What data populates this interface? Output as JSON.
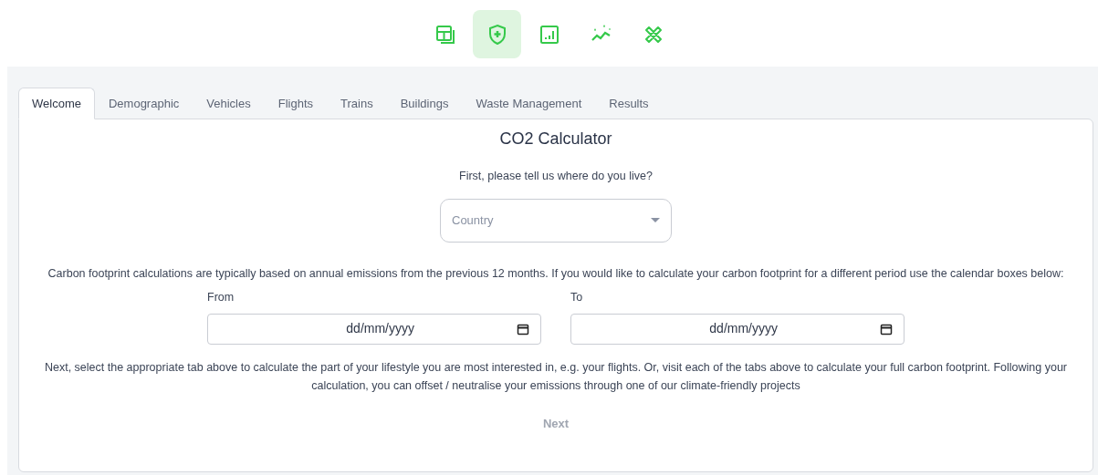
{
  "toolbar": [
    {
      "kind": "layout",
      "selected": false
    },
    {
      "kind": "shield",
      "selected": true
    },
    {
      "kind": "chart",
      "selected": false
    },
    {
      "kind": "trend",
      "selected": false
    },
    {
      "kind": "tools",
      "selected": false
    }
  ],
  "tabs": [
    {
      "label": "Welcome",
      "selected": true
    },
    {
      "label": "Demographic",
      "selected": false
    },
    {
      "label": "Vehicles",
      "selected": false
    },
    {
      "label": "Flights",
      "selected": false
    },
    {
      "label": "Trains",
      "selected": false
    },
    {
      "label": "Buildings",
      "selected": false
    },
    {
      "label": "Waste Management",
      "selected": false
    },
    {
      "label": "Results",
      "selected": false
    }
  ],
  "title": "CO2 Calculator",
  "question": "First, please tell us where do you live?",
  "country": {
    "placeholder": "Country"
  },
  "period_note": "Carbon footprint calculations are typically based on annual emissions from the previous 12 months. If you would like to calculate your carbon footprint for a different period use the calendar boxes below:",
  "dates": [
    {
      "label": "From",
      "value": "dd/mm/yyyy"
    },
    {
      "label": "To",
      "value": "dd/mm/yyyy"
    }
  ],
  "next_note": "Next, select the appropriate tab above to calculate the part of your lifestyle you are most interested in, e.g. your flights. Or, visit each of the tabs above to calculate your full carbon footprint. Following your calculation, you can offset / neutralise your emissions through one of our climate-friendly projects",
  "next_button": {
    "label": "Next",
    "disabled": true
  }
}
